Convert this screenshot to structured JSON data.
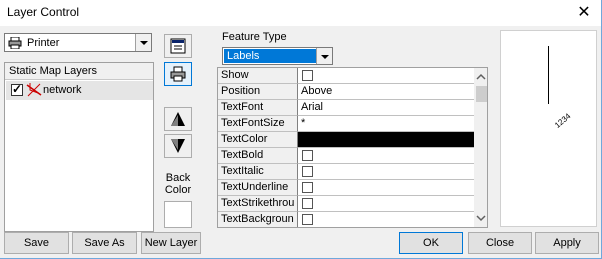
{
  "window": {
    "title": "Layer Control",
    "close_glyph": "✕"
  },
  "printer_dropdown": {
    "selected": "Printer",
    "icon": "printer-icon"
  },
  "layers": {
    "header": "Static Map Layers",
    "items": [
      {
        "label": "network",
        "checked": true,
        "icon": "layer-network-icon"
      }
    ]
  },
  "side_buttons": {
    "icons": [
      "properties-icon",
      "printer-icon",
      "move-up-icon",
      "move-down-icon"
    ],
    "back_color_label": "Back Color"
  },
  "feature_type": {
    "label": "Feature Type",
    "selected": "Labels"
  },
  "properties": [
    {
      "key": "Show",
      "type": "checkbox",
      "value": false
    },
    {
      "key": "Position",
      "type": "text",
      "value": "Above"
    },
    {
      "key": "TextFont",
      "type": "text",
      "value": "Arial"
    },
    {
      "key": "TextFontSize",
      "type": "text",
      "value": "*"
    },
    {
      "key": "TextColor",
      "type": "color",
      "value": "#000000"
    },
    {
      "key": "TextBold",
      "type": "checkbox",
      "value": false
    },
    {
      "key": "TextItalic",
      "type": "checkbox",
      "value": false
    },
    {
      "key": "TextUnderline",
      "type": "checkbox",
      "value": false
    },
    {
      "key": "TextStrikethrou",
      "type": "checkbox",
      "value": false
    },
    {
      "key": "TextBackgroun",
      "type": "checkbox",
      "value": false
    }
  ],
  "preview": {
    "label_text": "1234"
  },
  "buttons": {
    "save": "Save",
    "save_as": "Save As",
    "new_layer": "New Layer",
    "ok": "OK",
    "close": "Close",
    "apply": "Apply"
  },
  "colors": {
    "selection": "#0078d7",
    "window_bg": "#f0f0f0"
  }
}
